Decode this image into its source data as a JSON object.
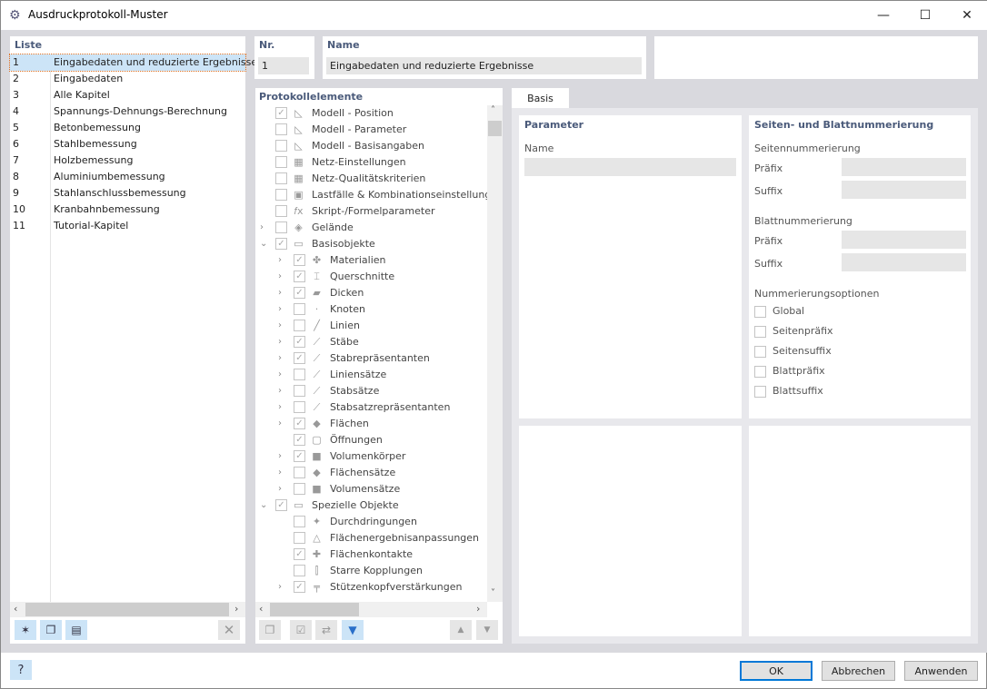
{
  "window": {
    "title": "Ausdruckprotokoll-Muster",
    "minimize": "—",
    "maximize": "☐",
    "close": "✕"
  },
  "list": {
    "header": "Liste",
    "items": [
      {
        "nr": "1",
        "name": "Eingabedaten und reduzierte Ergebnisse",
        "selected": true
      },
      {
        "nr": "2",
        "name": "Eingabedaten"
      },
      {
        "nr": "3",
        "name": "Alle Kapitel"
      },
      {
        "nr": "4",
        "name": "Spannungs-Dehnungs-Berechnung"
      },
      {
        "nr": "5",
        "name": "Betonbemessung"
      },
      {
        "nr": "6",
        "name": "Stahlbemessung"
      },
      {
        "nr": "7",
        "name": "Holzbemessung"
      },
      {
        "nr": "8",
        "name": "Aluminiumbemessung"
      },
      {
        "nr": "9",
        "name": "Stahlanschlussbemessung"
      },
      {
        "nr": "10",
        "name": "Kranbahnbemessung"
      },
      {
        "nr": "11",
        "name": "Tutorial-Kapitel"
      }
    ]
  },
  "nr": {
    "label": "Nr.",
    "value": "1"
  },
  "name": {
    "label": "Name",
    "value": "Eingabedaten und reduzierte Ergebnisse"
  },
  "elements": {
    "header": "Protokollelemente",
    "items": [
      {
        "level": 0,
        "exp": "",
        "checked": true,
        "icon": "model-icon",
        "label": "Modell - Position"
      },
      {
        "level": 0,
        "exp": "",
        "checked": false,
        "icon": "model-icon",
        "label": "Modell - Parameter"
      },
      {
        "level": 0,
        "exp": "",
        "checked": false,
        "icon": "model-icon",
        "label": "Modell - Basisangaben"
      },
      {
        "level": 0,
        "exp": "",
        "checked": false,
        "icon": "mesh-icon",
        "label": "Netz-Einstellungen"
      },
      {
        "level": 0,
        "exp": "",
        "checked": false,
        "icon": "mesh-icon",
        "label": "Netz-Qualitätskriterien"
      },
      {
        "level": 0,
        "exp": "",
        "checked": false,
        "icon": "load-cases-icon",
        "label": "Lastfälle & Kombinationseinstellungen"
      },
      {
        "level": 0,
        "exp": "",
        "checked": false,
        "icon": "formula-icon",
        "label": "Skript-/Formelparameter"
      },
      {
        "level": 0,
        "exp": "›",
        "checked": false,
        "icon": "terrain-icon",
        "label": "Gelände"
      },
      {
        "level": 0,
        "exp": "⌄",
        "checked": true,
        "icon": "folder-icon",
        "label": "Basisobjekte"
      },
      {
        "level": 1,
        "exp": "›",
        "checked": true,
        "icon": "materials-icon",
        "label": "Materialien"
      },
      {
        "level": 1,
        "exp": "›",
        "checked": true,
        "icon": "section-icon",
        "label": "Querschnitte"
      },
      {
        "level": 1,
        "exp": "›",
        "checked": true,
        "icon": "thickness-icon",
        "label": "Dicken"
      },
      {
        "level": 1,
        "exp": "›",
        "checked": false,
        "icon": "node-icon",
        "label": "Knoten"
      },
      {
        "level": 1,
        "exp": "›",
        "checked": false,
        "icon": "line-icon",
        "label": "Linien"
      },
      {
        "level": 1,
        "exp": "›",
        "checked": true,
        "icon": "member-icon",
        "label": "Stäbe"
      },
      {
        "level": 1,
        "exp": "›",
        "checked": true,
        "icon": "member-rep-icon",
        "label": "Stabrepräsentanten"
      },
      {
        "level": 1,
        "exp": "›",
        "checked": false,
        "icon": "line-set-icon",
        "label": "Liniensätze"
      },
      {
        "level": 1,
        "exp": "›",
        "checked": false,
        "icon": "member-set-icon",
        "label": "Stabsätze"
      },
      {
        "level": 1,
        "exp": "›",
        "checked": false,
        "icon": "member-set-rep-icon",
        "label": "Stabsatzrepräsentanten"
      },
      {
        "level": 1,
        "exp": "›",
        "checked": true,
        "icon": "surface-icon",
        "label": "Flächen"
      },
      {
        "level": 1,
        "exp": "",
        "checked": true,
        "icon": "opening-icon",
        "label": "Öffnungen"
      },
      {
        "level": 1,
        "exp": "›",
        "checked": true,
        "icon": "solid-icon",
        "label": "Volumenkörper"
      },
      {
        "level": 1,
        "exp": "›",
        "checked": false,
        "icon": "surface-set-icon",
        "label": "Flächensätze"
      },
      {
        "level": 1,
        "exp": "›",
        "checked": false,
        "icon": "solid-set-icon",
        "label": "Volumensätze"
      },
      {
        "level": 0,
        "exp": "⌄",
        "checked": true,
        "icon": "folder-icon",
        "label": "Spezielle Objekte"
      },
      {
        "level": 1,
        "exp": "",
        "checked": false,
        "icon": "intersection-icon",
        "label": "Durchdringungen"
      },
      {
        "level": 1,
        "exp": "",
        "checked": false,
        "icon": "result-adjust-icon",
        "label": "Flächenergebnisanpassungen"
      },
      {
        "level": 1,
        "exp": "",
        "checked": true,
        "icon": "surface-contact-icon",
        "label": "Flächenkontakte"
      },
      {
        "level": 1,
        "exp": "",
        "checked": false,
        "icon": "rigid-link-icon",
        "label": "Starre Kopplungen"
      },
      {
        "level": 1,
        "exp": "›",
        "checked": true,
        "icon": "column-head-icon",
        "label": "Stützenkopfverstärkungen"
      }
    ]
  },
  "tab": {
    "label": "Basis"
  },
  "parameter": {
    "header": "Parameter",
    "name_label": "Name",
    "name_value": ""
  },
  "numbering": {
    "header": "Seiten- und Blattnummerierung",
    "page_header": "Seitennummerierung",
    "sheet_header": "Blattnummerierung",
    "prefix": "Präfix",
    "suffix": "Suffix",
    "options_header": "Nummerierungsoptionen",
    "options": [
      {
        "label": "Global",
        "checked": false
      },
      {
        "label": "Seitenpräfix",
        "checked": false
      },
      {
        "label": "Seitensuffix",
        "checked": false
      },
      {
        "label": "Blattpräfix",
        "checked": false
      },
      {
        "label": "Blattsuffix",
        "checked": false
      }
    ]
  },
  "buttons": {
    "ok": "OK",
    "cancel": "Abbrechen",
    "apply": "Anwenden"
  },
  "colors": {
    "accent": "#0078d7",
    "selection": "#cce4f7",
    "header_text": "#4a5a7a"
  }
}
